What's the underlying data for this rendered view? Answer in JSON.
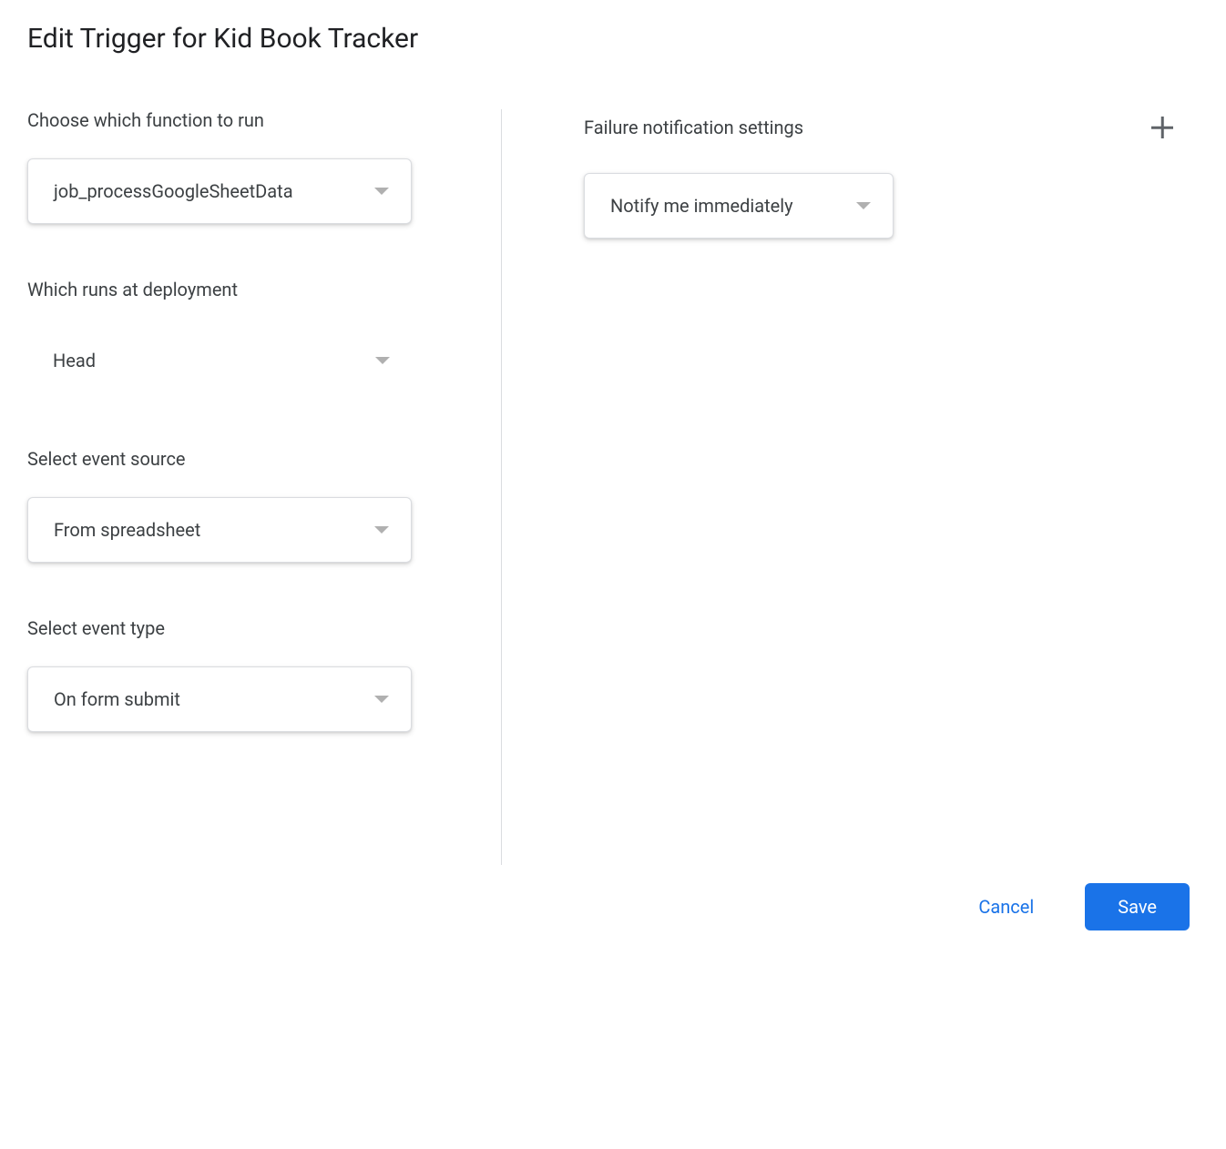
{
  "dialog": {
    "title": "Edit Trigger for Kid Book Tracker"
  },
  "left": {
    "function": {
      "label": "Choose which function to run",
      "value": "job_processGoogleSheetData"
    },
    "deployment": {
      "label": "Which runs at deployment",
      "value": "Head"
    },
    "eventSource": {
      "label": "Select event source",
      "value": "From spreadsheet"
    },
    "eventType": {
      "label": "Select event type",
      "value": "On form submit"
    }
  },
  "right": {
    "failure": {
      "label": "Failure notification settings",
      "value": "Notify me immediately"
    }
  },
  "footer": {
    "cancel": "Cancel",
    "save": "Save"
  }
}
